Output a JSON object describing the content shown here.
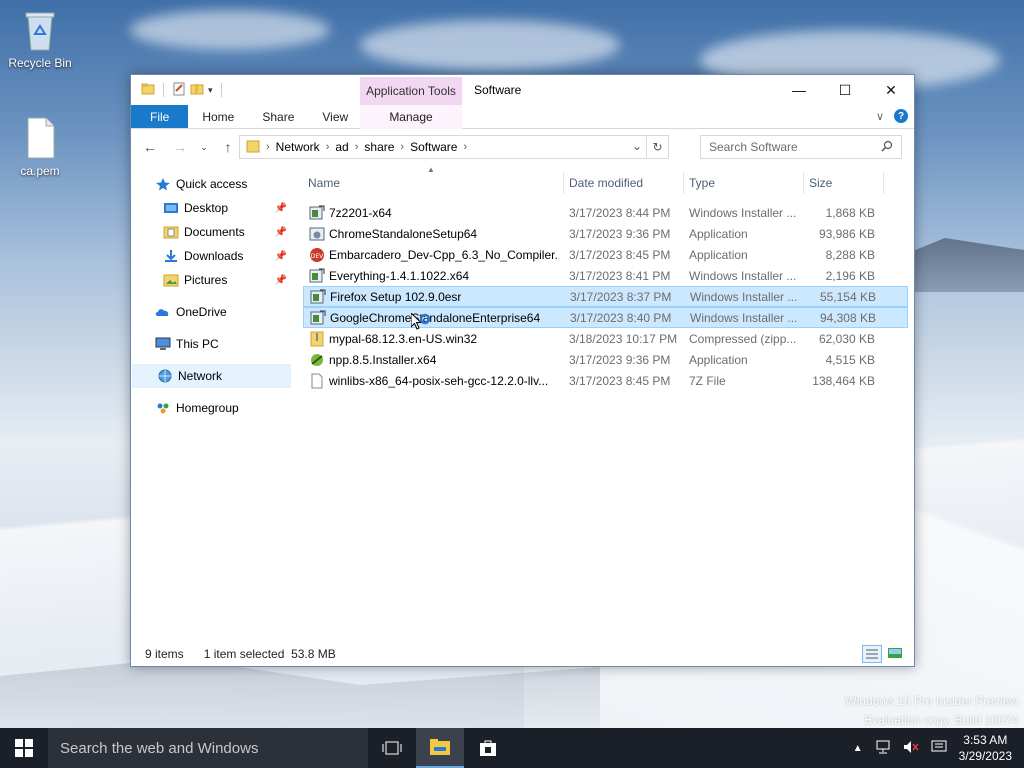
{
  "desktop": {
    "icons": [
      {
        "label": "Recycle Bin"
      },
      {
        "label": "ca.pem"
      }
    ],
    "watermark": {
      "line1": "Windows 10 Pro Insider Preview",
      "line2": "Evaluation copy. Build 10074"
    }
  },
  "window": {
    "title": "Software",
    "context_tab": "Application Tools",
    "ribbon_tabs": [
      "File",
      "Home",
      "Share",
      "View"
    ],
    "manage_tab": "Manage",
    "address": {
      "crumbs": [
        "Network",
        "ad",
        "share",
        "Software"
      ]
    },
    "search": {
      "placeholder": "Search Software"
    },
    "nav": {
      "quick_access": "Quick access",
      "pinned": [
        "Desktop",
        "Documents",
        "Downloads",
        "Pictures"
      ],
      "onedrive": "OneDrive",
      "this_pc": "This PC",
      "network": "Network",
      "homegroup": "Homegroup"
    },
    "columns": {
      "name": "Name",
      "date": "Date modified",
      "type": "Type",
      "size": "Size"
    },
    "files": [
      {
        "name": "7z2201-x64",
        "date": "3/17/2023 8:44 PM",
        "type": "Windows Installer ...",
        "size": "1,868 KB",
        "icon": "msi-icon",
        "selected": false
      },
      {
        "name": "ChromeStandaloneSetup64",
        "date": "3/17/2023 9:36 PM",
        "type": "Application",
        "size": "93,986 KB",
        "icon": "exe-icon",
        "selected": false
      },
      {
        "name": "Embarcadero_Dev-Cpp_6.3_No_Compiler...",
        "date": "3/17/2023 8:45 PM",
        "type": "Application",
        "size": "8,288 KB",
        "icon": "devcpp-icon",
        "selected": false
      },
      {
        "name": "Everything-1.4.1.1022.x64",
        "date": "3/17/2023 8:41 PM",
        "type": "Windows Installer ...",
        "size": "2,196 KB",
        "icon": "msi-icon",
        "selected": false
      },
      {
        "name": "Firefox Setup 102.9.0esr",
        "date": "3/17/2023 8:37 PM",
        "type": "Windows Installer ...",
        "size": "55,154 KB",
        "icon": "msi-icon",
        "selected": true
      },
      {
        "name": "GoogleChromeStandaloneEnterprise64",
        "date": "3/17/2023 8:40 PM",
        "type": "Windows Installer ...",
        "size": "94,308 KB",
        "icon": "msi-icon",
        "selected": true
      },
      {
        "name": "mypal-68.12.3.en-US.win32",
        "date": "3/18/2023 10:17 PM",
        "type": "Compressed (zipp...",
        "size": "62,030 KB",
        "icon": "zip-icon",
        "selected": false
      },
      {
        "name": "npp.8.5.Installer.x64",
        "date": "3/17/2023 9:36 PM",
        "type": "Application",
        "size": "4,515 KB",
        "icon": "npp-icon",
        "selected": false
      },
      {
        "name": "winlibs-x86_64-posix-seh-gcc-12.2.0-llv...",
        "date": "3/17/2023 8:45 PM",
        "type": "7Z File",
        "size": "138,464 KB",
        "icon": "file-icon",
        "selected": false
      }
    ],
    "status": {
      "count": "9 items",
      "selection": "1 item selected  53.8 MB"
    }
  },
  "taskbar": {
    "search_placeholder": "Search the web and Windows",
    "time": "3:53 AM",
    "date": "3/29/2023"
  }
}
